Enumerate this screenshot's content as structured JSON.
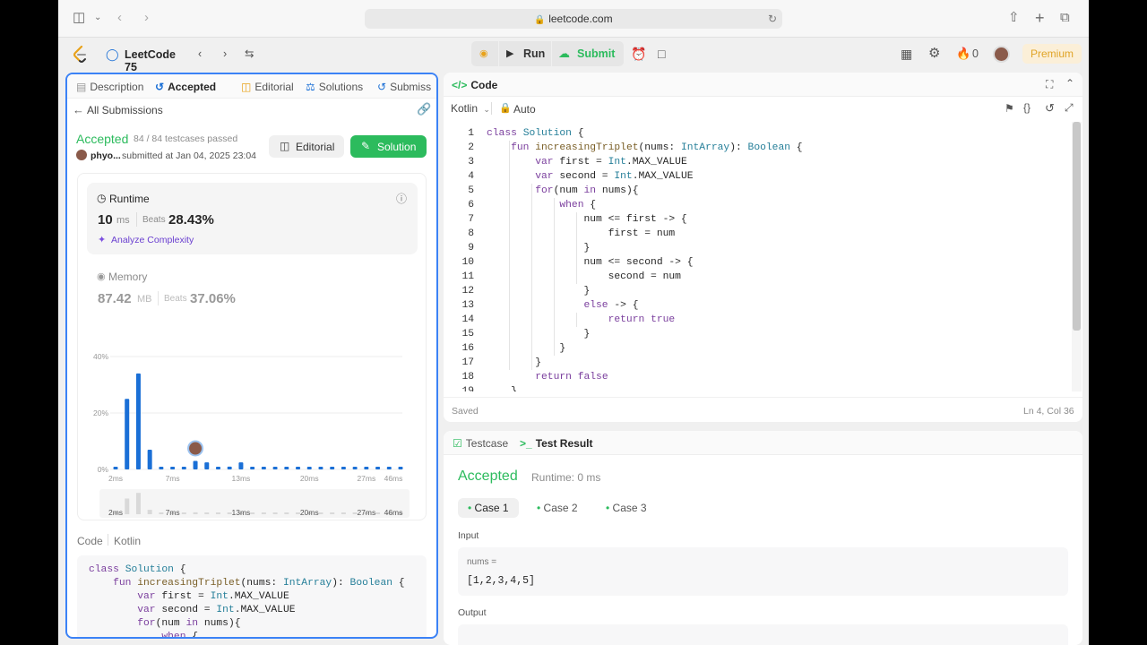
{
  "browser": {
    "url": "leetcode.com"
  },
  "topbar": {
    "study_plan": "LeetCode 75",
    "run_label": "Run",
    "submit_label": "Submit",
    "streak": "0",
    "premium_label": "Premium"
  },
  "left_tabs": [
    "Description",
    "Accepted",
    "Editorial",
    "Solutions",
    "Submiss"
  ],
  "submission": {
    "back_label": "All Submissions",
    "status": "Accepted",
    "testcases": "84 / 84 testcases passed",
    "user": "phyo...",
    "submitted": "submitted at Jan 04, 2025 23:04",
    "editorial_btn": "Editorial",
    "solution_btn": "Solution",
    "runtime_label": "Runtime",
    "runtime_value": "10",
    "runtime_unit": "ms",
    "beats_label": "Beats",
    "runtime_beats": "28.43%",
    "analyze_label": "Analyze Complexity",
    "memory_label": "Memory",
    "memory_value": "87.42",
    "memory_unit": "MB",
    "memory_beats": "37.06%",
    "code_label": "Code",
    "lang_label": "Kotlin"
  },
  "chart_data": {
    "type": "bar",
    "y_ticks": [
      "40%",
      "20%",
      "0%"
    ],
    "ylim": [
      0,
      40
    ],
    "x_ticks": [
      "2ms",
      "7ms",
      "13ms",
      "20ms",
      "27ms",
      "46ms"
    ],
    "values": [
      0.5,
      25,
      34,
      7,
      0.7,
      0.7,
      0.7,
      3,
      2.5,
      0.7,
      1,
      2.5,
      0.7,
      0.7,
      0.7,
      0.7,
      0.7,
      0.7,
      0.7,
      0.7,
      0.7,
      0.7,
      0.7,
      0.7,
      0.7,
      0.7
    ],
    "highlight_index": 7,
    "colors": {
      "bar": "#1a6fd6",
      "mini": "#d9d9d9"
    }
  },
  "code_preview": [
    "class Solution {",
    "    fun increasingTriplet(nums: IntArray): Boolean {",
    "        var first = Int.MAX_VALUE",
    "        var second = Int.MAX_VALUE",
    "        for(num in nums){",
    "            when {"
  ],
  "editor": {
    "title": "Code",
    "language": "Kotlin",
    "mode": "Auto",
    "status": "Saved",
    "cursor": "Ln 4, Col 36",
    "lines": [
      "class Solution {",
      "    fun increasingTriplet(nums: IntArray): Boolean {",
      "        var first = Int.MAX_VALUE",
      "        var second = Int.MAX_VALUE",
      "        for(num in nums){",
      "            when {",
      "                num <= first -> {",
      "                    first = num",
      "                }",
      "                num <= second -> {",
      "                    second = num",
      "                }",
      "                else -> {",
      "                    return true",
      "                }",
      "            }",
      "        }",
      "        return false",
      "    }"
    ]
  },
  "result": {
    "testcase_tab": "Testcase",
    "result_tab": "Test Result",
    "status": "Accepted",
    "runtime": "Runtime: 0 ms",
    "cases": [
      "Case 1",
      "Case 2",
      "Case 3"
    ],
    "input_label": "Input",
    "param_label": "nums =",
    "param_value": "[1,2,3,4,5]",
    "output_label": "Output"
  }
}
